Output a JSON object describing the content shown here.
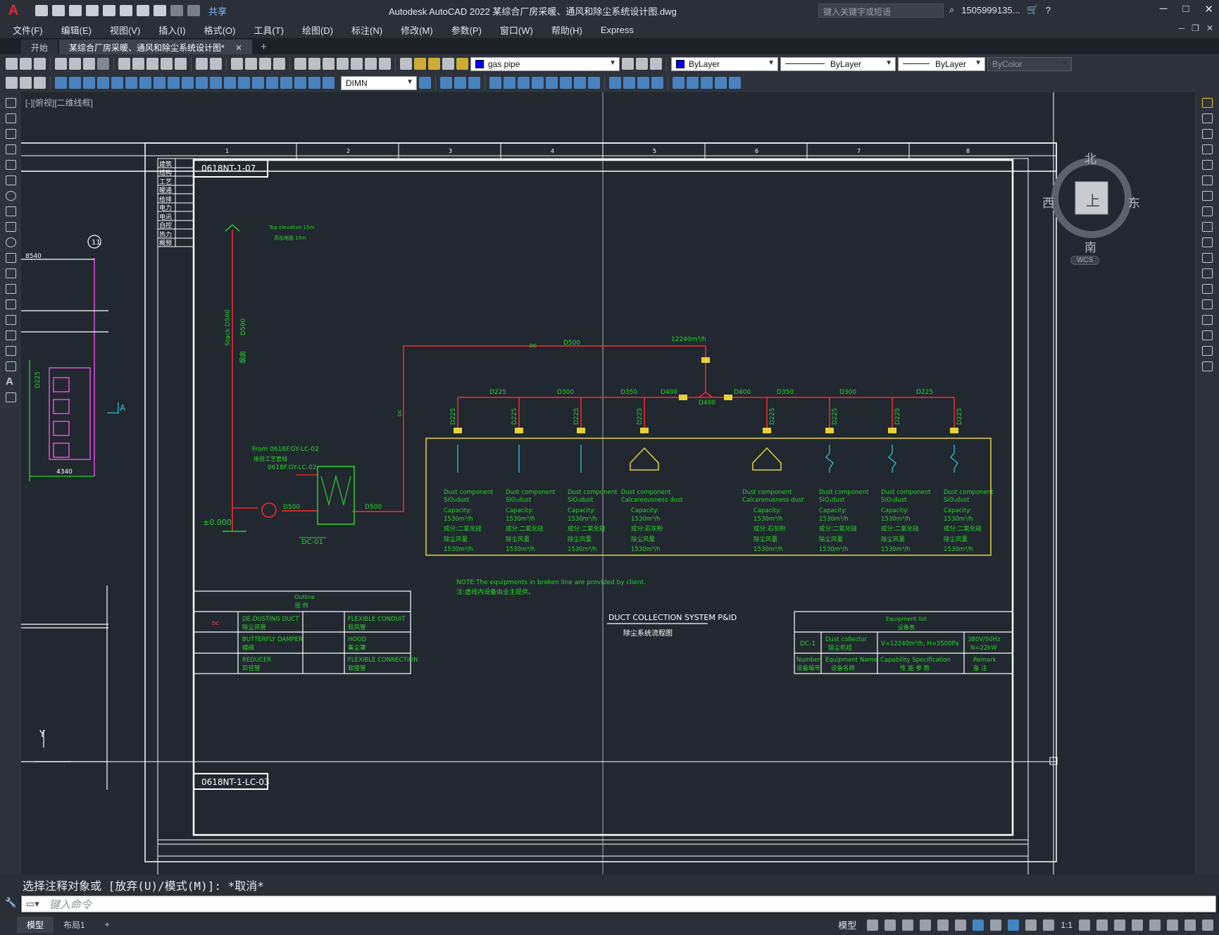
{
  "titlebar": {
    "app_logo": "A",
    "share_label": "共享",
    "title": "Autodesk AutoCAD 2022    某综合厂房采暖、通风和除尘系统设计图.dwg",
    "search_placeholder": "键入关键字或短语",
    "user": "1505999135...",
    "help": "?"
  },
  "menu": [
    "文件(F)",
    "编辑(E)",
    "视图(V)",
    "插入(I)",
    "格式(O)",
    "工具(T)",
    "绘图(D)",
    "标注(N)",
    "修改(M)",
    "参数(P)",
    "窗口(W)",
    "帮助(H)",
    "Express"
  ],
  "tabs": {
    "start": "开始",
    "active": "某综合厂房采暖、通风和除尘系统设计图*",
    "add": "+"
  },
  "toolbar": {
    "layer": "gas pipe",
    "color": "ByLayer",
    "linetype": "ByLayer",
    "lineweight": "ByLayer",
    "plotstyle": "ByColor",
    "dimstyle": "DIMN",
    "layer_color": "#0000ff"
  },
  "viewport": {
    "label": "[-][俯视][二维线框]",
    "viewcube": {
      "north": "北",
      "south": "南",
      "east": "东",
      "west": "西",
      "face": "上",
      "wcs": "WCS"
    }
  },
  "drawing": {
    "drawing_no_top": "0618NT-1-07",
    "drawing_no_bottom": "0618NT-1-LC-03",
    "col_numbers": [
      "1",
      "2",
      "3",
      "4",
      "5",
      "6",
      "7",
      "8"
    ],
    "left_strip": [
      "建筑",
      "结构",
      "工艺",
      "暖通",
      "给排",
      "电力",
      "电讯",
      "自控",
      "热力",
      "概预"
    ],
    "top_elevation": "Top elevation 15m",
    "top_elevation_cn": "高出地面  15m",
    "stack": "Stack D500",
    "stack_cn": "烟囱",
    "stack_d": "D500",
    "from_label": "From 0618F.GY-LC-02",
    "from_cn": "接自工艺管线",
    "from_ref": "0618F.GY-LC-02",
    "elevation_zero": "±0.000",
    "fan_duct": "D500",
    "collector_out": "D500",
    "collector_tag": "DC-01",
    "main_duct": "D500",
    "flow_total": "12240m³/h",
    "duct_dc": "DC",
    "branch_sizes": [
      "D225",
      "D300",
      "D350",
      "D400",
      "D400",
      "D350",
      "D300",
      "D225"
    ],
    "node_label": "D400",
    "drop_size": "D225",
    "hoods": [
      {
        "comp": "Dust component",
        "type": "SiO₂dust",
        "cap": "Capacity:",
        "flow": "1530m³/h",
        "cn1": "成分:二氧化硅",
        "cn2": "除尘风量",
        "flow2": "1530m³/h"
      },
      {
        "comp": "Dust component",
        "type": "SiO₂dust",
        "cap": "Capacity:",
        "flow": "1530m³/h",
        "cn1": "成分:二氧化硅",
        "cn2": "除尘风量",
        "flow2": "1530m³/h"
      },
      {
        "comp": "Dust component",
        "type": "SiO₂dust",
        "cap": "Capacity:",
        "flow": "1530m³/h",
        "cn1": "成分:二氧化硅",
        "cn2": "除尘风量",
        "flow2": "1530m³/h"
      },
      {
        "comp": "Dust component",
        "type": "Calcareousness dust",
        "cap": "Capacity:",
        "flow": "1530m³/h",
        "cn1": "成分:石灰粉",
        "cn2": "除尘风量",
        "flow2": "1530m³/h"
      },
      {
        "comp": "Dust component",
        "type": "Calcareousness dust",
        "cap": "Capacity:",
        "flow": "1530m³/h",
        "cn1": "成分:石灰粉",
        "cn2": "除尘风量",
        "flow2": "1530m³/h"
      },
      {
        "comp": "Dust component",
        "type": "SiO₂dust",
        "cap": "Capacity:",
        "flow": "1530m³/h",
        "cn1": "成分:二氧化硅",
        "cn2": "除尘风量",
        "flow2": "1530m³/h"
      },
      {
        "comp": "Dust component",
        "type": "SiO₂dust",
        "cap": "Capacity:",
        "flow": "1530m³/h",
        "cn1": "成分:二氧化硅",
        "cn2": "除尘风量",
        "flow2": "1530m³/h"
      },
      {
        "comp": "Dust component",
        "type": "SiO₂dust",
        "cap": "Capacity:",
        "flow": "1530m³/h",
        "cn1": "成分:二氧化硅",
        "cn2": "除尘风量",
        "flow2": "1530m³/h"
      }
    ],
    "note": "NOTE:The equipments in broken line are provided by client.",
    "note_cn": "注:虚线内设备由业主提供。",
    "plan_title": "DUCT COLLECTION SYSTEM P&ID",
    "plan_title_cn": "除尘系统流程图",
    "legend": {
      "title": "Outline",
      "title_cn": "图 例",
      "rows": [
        {
          "sym": "DC",
          "en": "DE-DUSTING DUCT",
          "cn": "除尘风管",
          "en2": "FLEXIBLE CONDUIT",
          "cn2": "软风管"
        },
        {
          "sym": "",
          "en": "BUTTERFLY DAMPER",
          "cn": "蝶阀",
          "en2": "HOOD",
          "cn2": "集尘罩"
        },
        {
          "sym": "",
          "en": "REDUCER",
          "cn": "异径管",
          "en2": "FLEXIBLE CONNECTION",
          "cn2": "软接管"
        }
      ]
    },
    "equip": {
      "title": "Equipment list",
      "title_cn": "设备表",
      "no": "DC-1",
      "name": "Dust collector",
      "name_cn": "除尘机组",
      "spec": "V=12240m³/h, H=3500Pa",
      "remark1": "380V/50Hz",
      "remark2": "N=22kW",
      "h_no": "Number",
      "h_no_cn": "设备编号",
      "h_name": "Equipment Name",
      "h_name_cn": "设备名称",
      "h_spec": "Capability Specification",
      "h_spec_cn": "性 能 参 数",
      "h_remark": "Remark",
      "h_remark_cn": "备 注"
    },
    "left_partial": {
      "dim1": "8540",
      "dim2": "4340",
      "grid": "11",
      "sect": "A",
      "duct": "D225",
      "axis_y": "Y"
    }
  },
  "command": {
    "history": "选择注释对象或 [放弃(U)/模式(M)]: *取消*",
    "placeholder": "键入命令"
  },
  "status": {
    "model_tab": "模型",
    "layout_tab": "布局1",
    "add": "+",
    "model_label": "模型",
    "scale": "1:1"
  }
}
